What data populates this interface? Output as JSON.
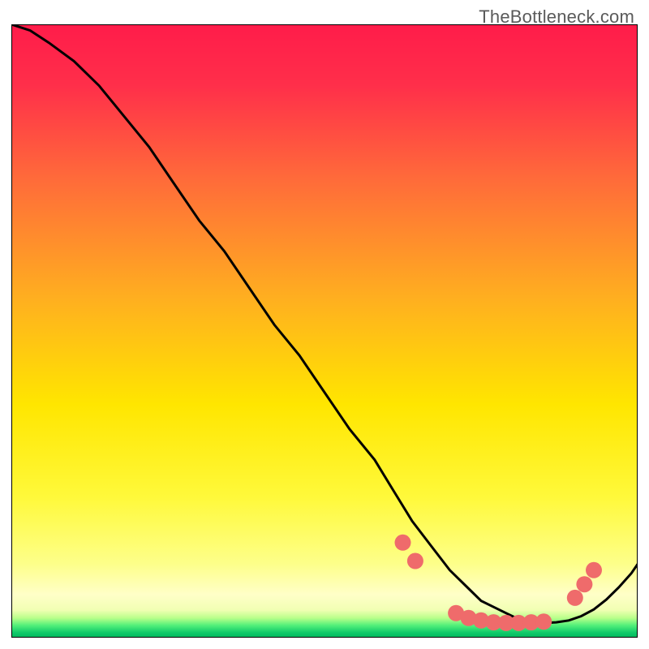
{
  "watermark": "TheBottleneck.com",
  "chart_data": {
    "type": "line",
    "title": "",
    "xlabel": "",
    "ylabel": "",
    "xlim": [
      0,
      100
    ],
    "ylim": [
      0,
      100
    ],
    "gradient_stops": [
      {
        "offset": 0.0,
        "color": "#ff1c4a"
      },
      {
        "offset": 0.1,
        "color": "#ff2f4a"
      },
      {
        "offset": 0.25,
        "color": "#ff6a3a"
      },
      {
        "offset": 0.45,
        "color": "#ffb01f"
      },
      {
        "offset": 0.62,
        "color": "#ffe600"
      },
      {
        "offset": 0.77,
        "color": "#fff93a"
      },
      {
        "offset": 0.88,
        "color": "#fdff8a"
      },
      {
        "offset": 0.93,
        "color": "#ffffc8"
      },
      {
        "offset": 0.955,
        "color": "#f1ffb3"
      },
      {
        "offset": 0.968,
        "color": "#b9ff8a"
      },
      {
        "offset": 0.98,
        "color": "#52f07a"
      },
      {
        "offset": 0.992,
        "color": "#0fc969"
      },
      {
        "offset": 1.0,
        "color": "#00b85f"
      }
    ],
    "series": [
      {
        "name": "curve",
        "x": [
          0,
          3,
          6,
          10,
          14,
          18,
          22,
          26,
          30,
          34,
          38,
          42,
          46,
          50,
          54,
          58,
          61,
          64,
          67,
          70,
          73,
          75,
          77,
          79,
          81,
          83,
          85,
          87,
          89,
          91,
          93,
          95,
          97,
          99,
          100
        ],
        "y": [
          100,
          99,
          97,
          94,
          90,
          85,
          80,
          74,
          68,
          63,
          57,
          51,
          46,
          40,
          34,
          29,
          24,
          19,
          15,
          11,
          8,
          6,
          5,
          4,
          3,
          2.6,
          2.4,
          2.5,
          2.8,
          3.5,
          4.6,
          6.2,
          8.2,
          10.5,
          12
        ]
      }
    ],
    "markers": {
      "name": "dots",
      "color": "#ef6b6b",
      "radius": 10,
      "points": [
        {
          "x": 62.5,
          "y": 15.5
        },
        {
          "x": 64.5,
          "y": 12.5
        },
        {
          "x": 71.0,
          "y": 4.0
        },
        {
          "x": 73.0,
          "y": 3.2
        },
        {
          "x": 75.0,
          "y": 2.8
        },
        {
          "x": 77.0,
          "y": 2.5
        },
        {
          "x": 79.0,
          "y": 2.4
        },
        {
          "x": 81.0,
          "y": 2.4
        },
        {
          "x": 83.0,
          "y": 2.5
        },
        {
          "x": 85.0,
          "y": 2.6
        },
        {
          "x": 90.0,
          "y": 6.5
        },
        {
          "x": 91.5,
          "y": 8.7
        },
        {
          "x": 93.0,
          "y": 11.0
        }
      ]
    }
  }
}
